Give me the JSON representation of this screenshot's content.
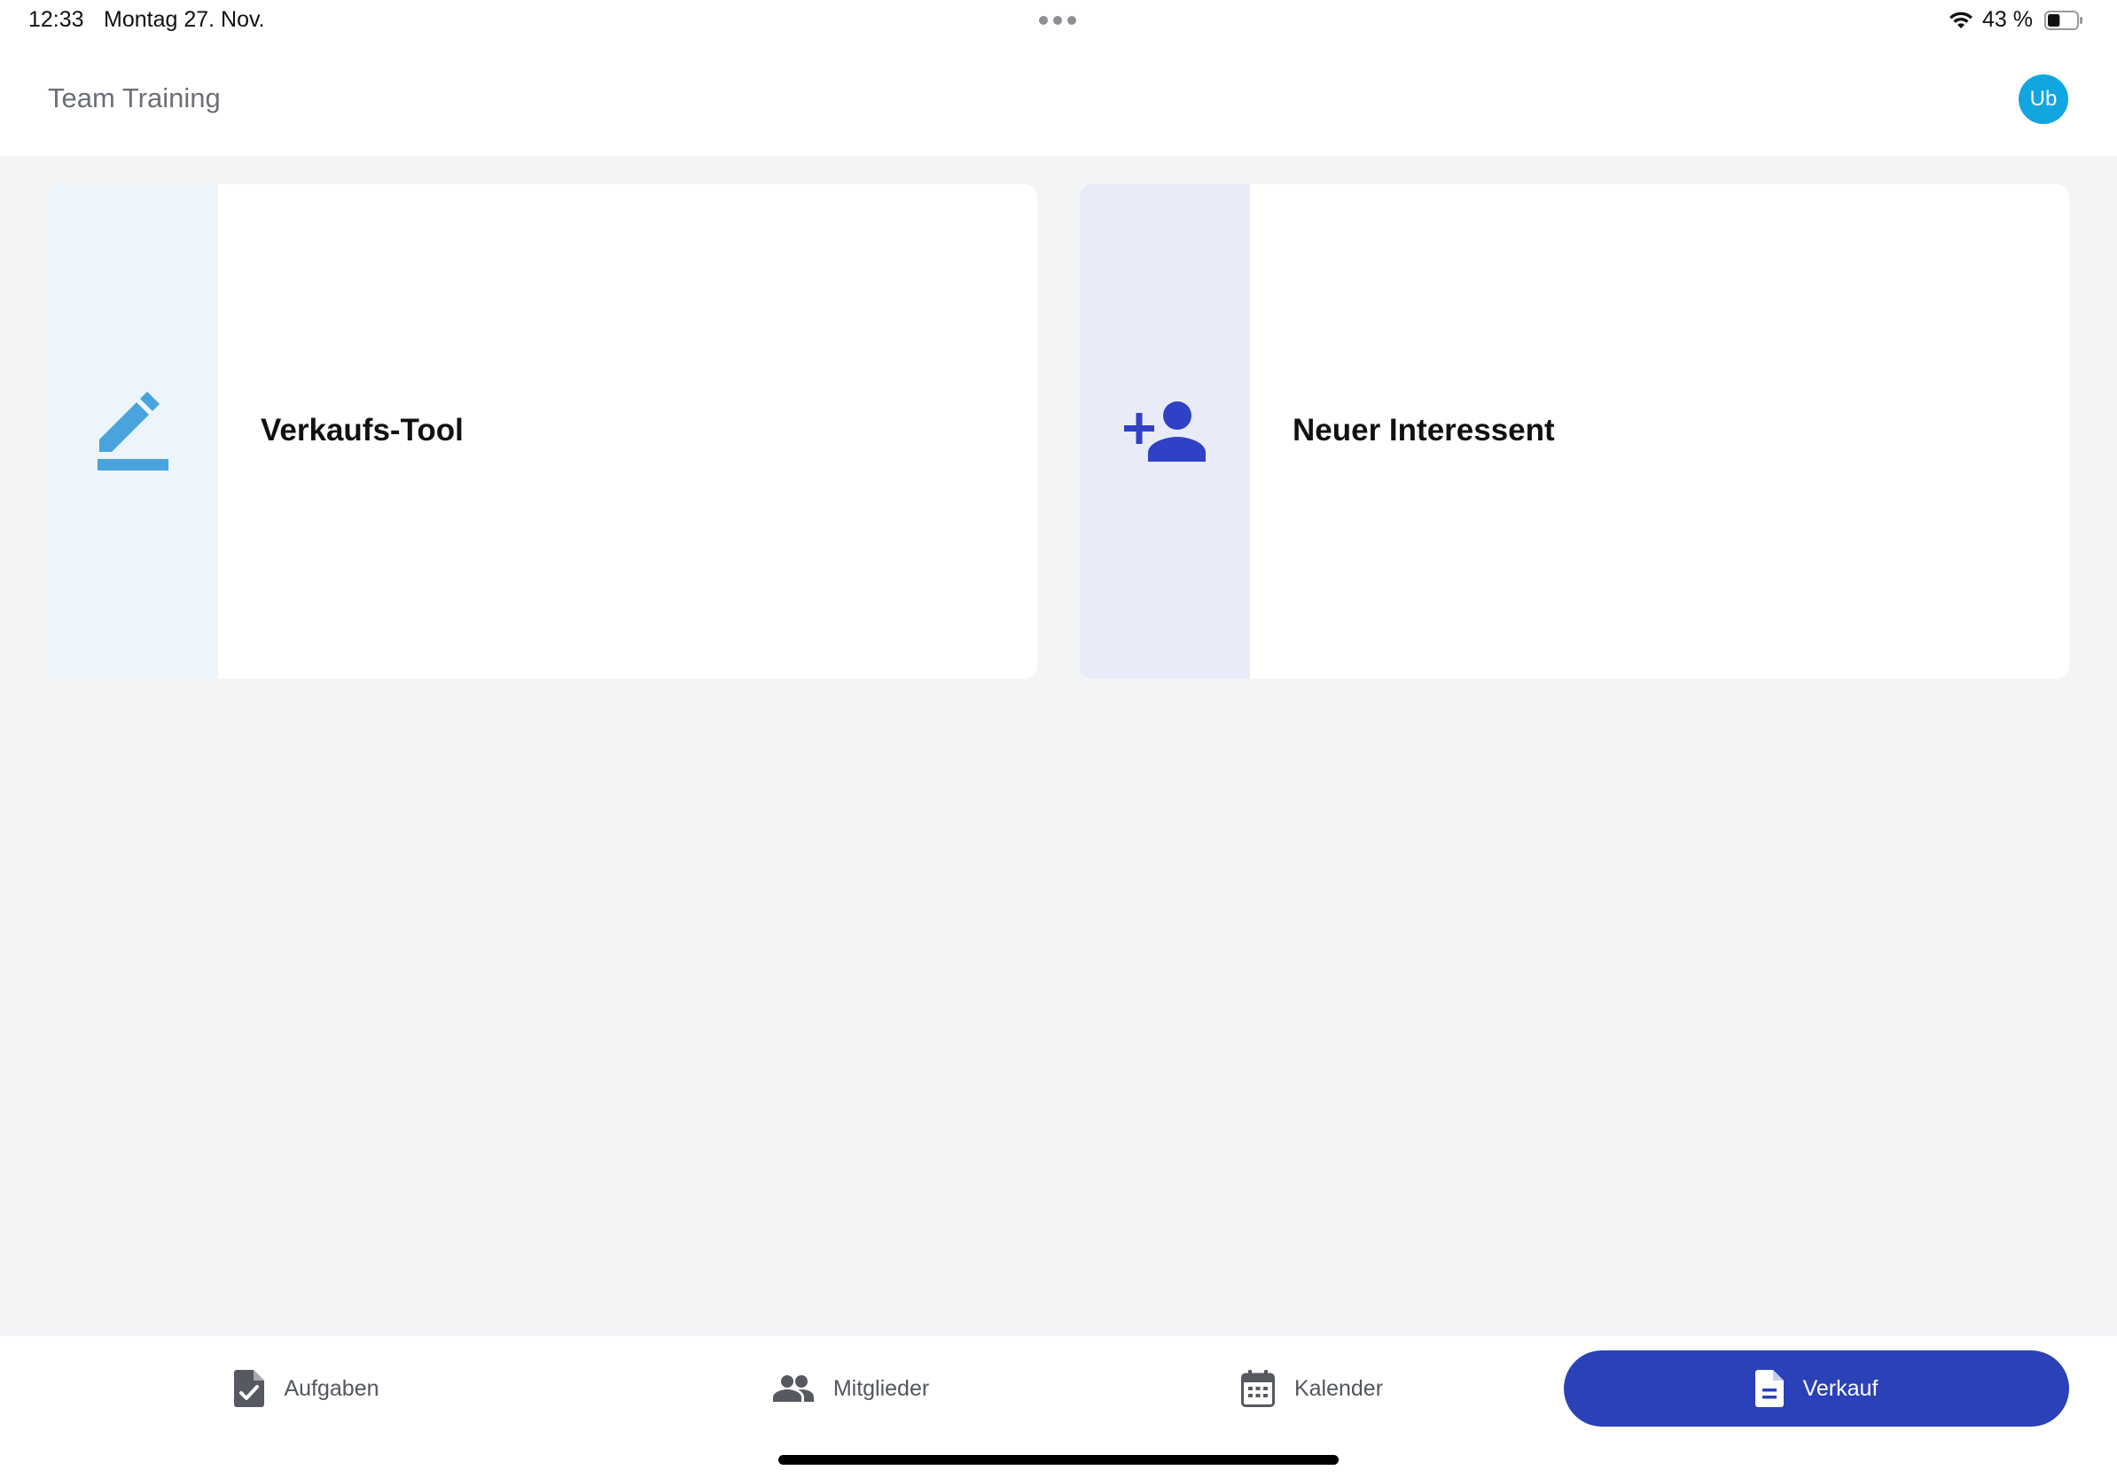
{
  "status_bar": {
    "time": "12:33",
    "date": "Montag 27. Nov.",
    "battery_percent": "43 %",
    "battery_level": 0.43,
    "icons": [
      "more-dots-icon",
      "wifi-icon",
      "battery-icon"
    ]
  },
  "header": {
    "title": "Team Training",
    "avatar_initials": "Ub",
    "avatar_color": "#11a6e0"
  },
  "cards": [
    {
      "label": "Verkaufs-Tool",
      "icon": "pencil-icon",
      "icon_color": "#4aa3dd",
      "panel_color": "#edf5fc"
    },
    {
      "label": "Neuer Interessent",
      "icon": "add-person-icon",
      "icon_color": "#2f41c7",
      "panel_color": "#e9ebf8"
    }
  ],
  "bottom_nav": {
    "items": [
      {
        "label": "Aufgaben",
        "icon": "task-check-icon",
        "active": false
      },
      {
        "label": "Mitglieder",
        "icon": "people-icon",
        "active": false
      },
      {
        "label": "Kalender",
        "icon": "calendar-icon",
        "active": false
      },
      {
        "label": "Verkauf",
        "icon": "document-icon",
        "active": true
      }
    ],
    "active_color": "#2a41b8"
  }
}
